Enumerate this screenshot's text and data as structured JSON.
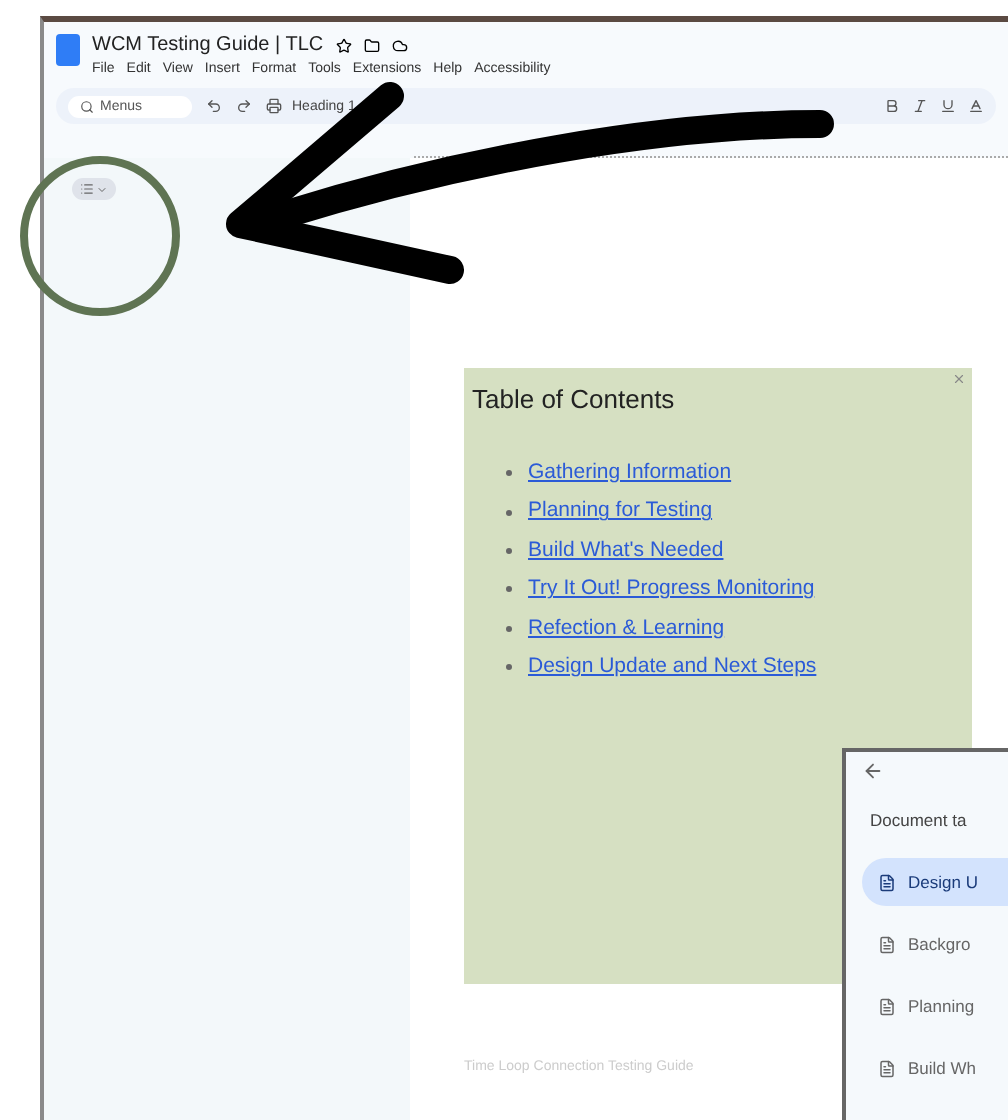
{
  "document": {
    "title": "WCM Testing Guide | TLC",
    "menu": [
      "File",
      "Edit",
      "View",
      "Insert",
      "Format",
      "Tools",
      "Extensions",
      "Help",
      "Accessibility"
    ]
  },
  "toolbar": {
    "search": {
      "placeholder": "Menus"
    },
    "style": "Heading 1"
  },
  "toc": {
    "title": "Table of Contents",
    "links": [
      "Gathering Information",
      "Planning for Testing",
      "Build What's Needed",
      "Try It Out! Progress Monitoring",
      "Refection & Learning",
      "Design Update and Next Steps"
    ]
  },
  "footer": "Time Loop Connection Testing Guide",
  "tabs_panel": {
    "heading": "Document ta",
    "tabs": [
      {
        "label": "Design U",
        "selected": true
      },
      {
        "label": "Backgro",
        "selected": false
      },
      {
        "label": "Planning",
        "selected": false
      },
      {
        "label": "Build Wh",
        "selected": false
      }
    ]
  }
}
